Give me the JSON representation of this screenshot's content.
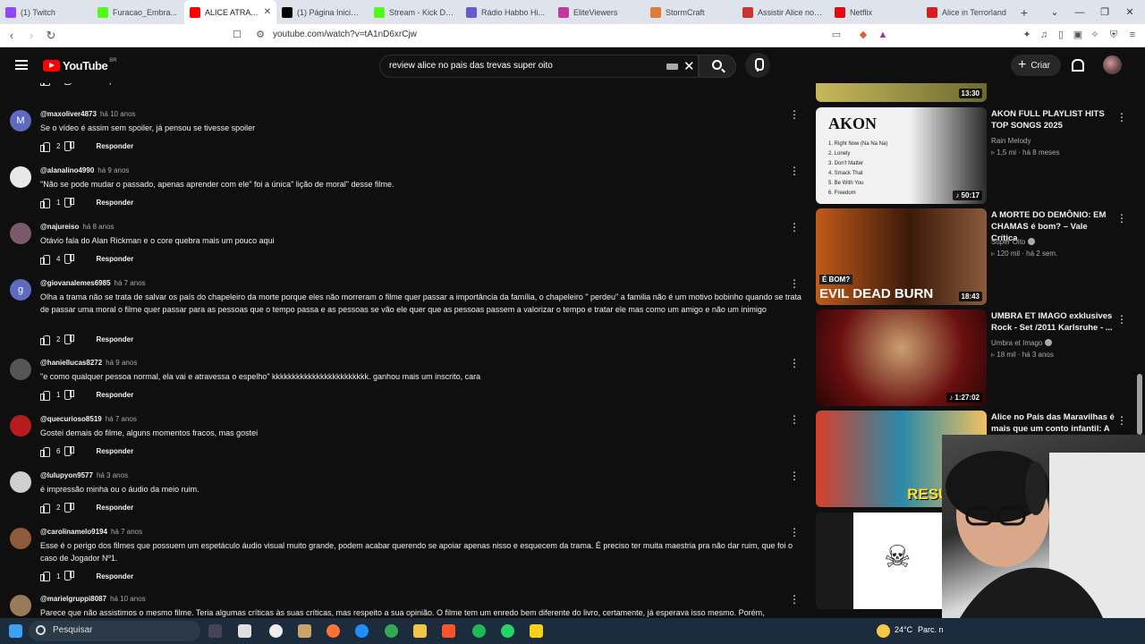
{
  "browser": {
    "tabs": [
      {
        "label": "(1) Twitch",
        "color": "#9146ff"
      },
      {
        "label": "Furacao_Embra...",
        "color": "#53fc18"
      },
      {
        "label": "ALICE ATRAVES...",
        "color": "#ff0000",
        "active": true
      },
      {
        "label": "(1) Página Inicial / X",
        "color": "#000000"
      },
      {
        "label": "Stream - Kick Dash...",
        "color": "#53fc18"
      },
      {
        "label": "Rádio Habbo Hi...",
        "color": "#6a5acd"
      },
      {
        "label": "EliteViewers",
        "color": "#c0399f"
      },
      {
        "label": "StormCraft",
        "color": "#e07b39"
      },
      {
        "label": "Assistir Alice no Pa...",
        "color": "#cc3333"
      },
      {
        "label": "Netflix",
        "color": "#e50914"
      },
      {
        "label": "Alice in Terrorland",
        "color": "#d42020"
      }
    ],
    "url": "youtube.com/watch?v=tA1nD6xrCjw"
  },
  "header": {
    "logo_word": "YouTube",
    "country": "BR",
    "search_query": "review alice no pais das trevas super oito",
    "create_label": "Criar"
  },
  "comments": [
    {
      "user": "",
      "when": "",
      "text": "",
      "likes": "3",
      "reply": "Responder",
      "action_only": true
    },
    {
      "user": "@maxoliver4873",
      "when": "há 10 anos",
      "text": "Se o vídeo é assim sem spoiler, já pensou se tivesse spoiler",
      "likes": "2",
      "reply": "Responder",
      "avatar_letter": "M",
      "avatar_color": "#5c6bc0"
    },
    {
      "user": "@alanalino4990",
      "when": "há 9 anos",
      "text": "\"Não se pode mudar o passado, apenas aprender com ele\" foi a única\" lição de moral\" desse filme.",
      "likes": "1",
      "reply": "Responder",
      "avatar_letter": "",
      "avatar_color": "#e8e8e8"
    },
    {
      "user": "@najureiso",
      "when": "há 8 anos",
      "text": "Otávio fala do Alan Rickman e o core quebra mais um pouco aqui",
      "likes": "4",
      "reply": "Responder",
      "avatar_letter": "",
      "avatar_color": "#7a5a6a"
    },
    {
      "user": "@giovanalemes6985",
      "when": "há 7 anos",
      "text": "Olha a trama não  se trata de salvar os país do chapeleiro da morte porque eles não morreram  o filme quer passar a importância da família, o chapeleiro \" perdeu\" a familia  não  é um motivo bobinho quando se trata de passar uma moral o filme  quer passar para as pessoas que o tempo passa e as pessoas se vão  ele quer que as pessoas passem a valorizar o tempo e tratar ele mas como um amigo e não um inimigo",
      "likes": "2",
      "reply": "Responder",
      "avatar_letter": "g",
      "avatar_color": "#5c6bc0"
    },
    {
      "user": "@haniellucas8272",
      "when": "há 9 anos",
      "text": "\"e como qualquer pessoa normal, ela vai e atravessa o espelho\" kkkkkkkkkkkkkkkkkkkkkkkk. ganhou mais um inscrito, cara",
      "likes": "1",
      "reply": "Responder",
      "avatar_letter": "",
      "avatar_color": "#555555"
    },
    {
      "user": "@quecurioso8519",
      "when": "há 7 anos",
      "text": "Gostei demais do filme, alguns momentos fracos, mas gostei",
      "likes": "6",
      "reply": "Responder",
      "avatar_letter": "",
      "avatar_color": "#b71c1c"
    },
    {
      "user": "@lulupyon9577",
      "when": "há 3 anos",
      "text": "é impressão minha ou o áudio da meio ruim.",
      "likes": "2",
      "reply": "Responder",
      "avatar_letter": "",
      "avatar_color": "#cfcfcf"
    },
    {
      "user": "@carolinamelo9194",
      "when": "há 7 anos",
      "text": "Esse é o perigo dos filmes que possuem um espetáculo áudio visual muito grande, podem acabar querendo se apoiar apenas nisso e esquecem da trama. É preciso ter muita maestria pra não dar ruim, que foi o caso de Jogador Nº1.",
      "likes": "1",
      "reply": "Responder",
      "avatar_letter": "",
      "avatar_color": "#8d5a3a"
    },
    {
      "user": "@marielgruppi8087",
      "when": "há 10 anos",
      "text": "Parece que não assistimos o mesmo filme. Teria algumas críticas às suas críticas, mas respeito a sua opinião. O filme tem um enredo bem diferente do livro, certamente, já esperava isso mesmo. Porém,",
      "likes": "",
      "reply": "",
      "avatar_letter": "",
      "avatar_color": "#9a7a5a"
    }
  ],
  "sidebar": {
    "recommendations": [
      {
        "title": "",
        "channel": "",
        "views": "",
        "age": "",
        "duration": "13:30",
        "thumb": "#8a7a30"
      },
      {
        "title": "AKON FULL PLAYLIST HITS TOP SONGS 2025",
        "channel": "Rain Melody",
        "views": "1,5 mi",
        "age": "há 8 meses",
        "duration": "50:17",
        "thumb": "#e8e8e8",
        "thumb_text": "AKON",
        "thumb_list": [
          "1. Right Now (Na Na Na)",
          "2. Lonely",
          "3. Don't Matter",
          "4. Smack That",
          "5. Be With You",
          "6. Freedom"
        ],
        "music": true
      },
      {
        "title": "A MORTE DO DEMÔNIO: EM CHAMAS é bom? – Vale Crítica",
        "channel": "Super Oito",
        "views": "120 mil",
        "age": "há 2 sem.",
        "duration": "18:43",
        "thumb": "#5a2a10",
        "thumb_text": "EVIL DEAD BURN",
        "thumb_tag": "É BOM?",
        "verified": true
      },
      {
        "title": "UMBRA ET IMAGO exklusives Rock - Set /2011 Karlsruhe - ...",
        "channel": "Umbra et Imago",
        "views": "18 mil",
        "age": "há 3 anos",
        "duration": "1:27:02",
        "thumb": "#5a1010",
        "verified": true,
        "music": true
      },
      {
        "title": "Alice no País das Maravilhas é mais que um conto infantil: A ...",
        "channel": "",
        "views": "",
        "age": "",
        "duration": "",
        "thumb": "#3a6a8a",
        "thumb_text": "RESUMÃO"
      },
      {
        "title": "",
        "channel": "",
        "views": "",
        "age": "",
        "duration": "",
        "thumb": "#ffffff"
      }
    ]
  },
  "taskbar": {
    "search_label": "Pesquisar",
    "weather": "24°C",
    "weather_note": "Parc. n"
  }
}
